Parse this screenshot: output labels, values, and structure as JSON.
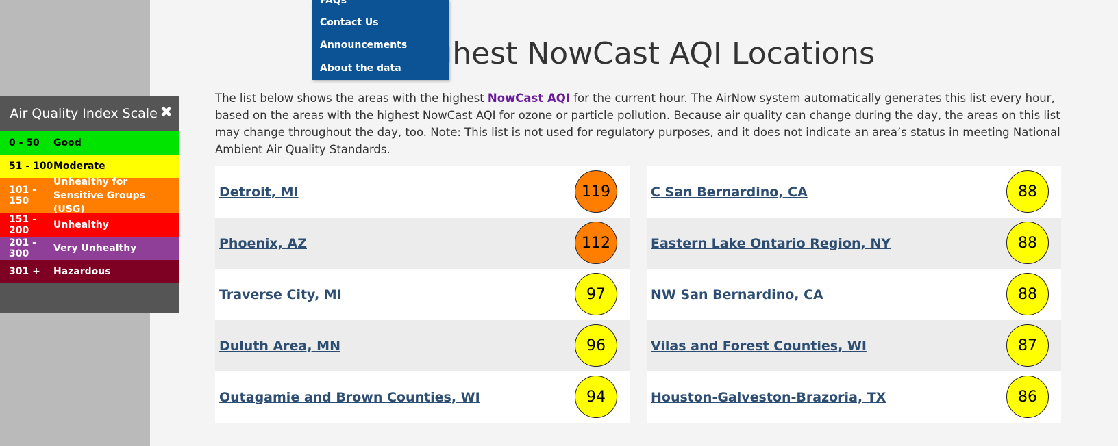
{
  "dropdown": {
    "items": [
      "FAQs",
      "Contact Us",
      "Announcements",
      "About the data"
    ]
  },
  "main": {
    "title": "Highest NowCast AQI Locations",
    "intro_before_link": "The list below shows the areas with the highest ",
    "intro_link": "NowCast AQI",
    "intro_after_link": " for the current hour. The AirNow system automatically generates this list every hour, based on the areas with the highest NowCast AQI for ozone or particle pollution. Because air quality can change during the day, the areas on this list may change throughout the day, too. Note: This list is not used for regulatory purposes, and it does not indicate an area’s status in meeting National Ambient Air Quality Standards."
  },
  "locations_left": [
    {
      "name": "Detroit, MI",
      "aqi": "119",
      "color": "#ff7e00"
    },
    {
      "name": "Phoenix, AZ",
      "aqi": "112",
      "color": "#ff7e00"
    },
    {
      "name": "Traverse City, MI",
      "aqi": "97",
      "color": "#ffff00"
    },
    {
      "name": "Duluth Area, MN",
      "aqi": "96",
      "color": "#ffff00"
    },
    {
      "name": "Outagamie and Brown Counties, WI",
      "aqi": "94",
      "color": "#ffff00"
    }
  ],
  "locations_right": [
    {
      "name": "C San Bernardino, CA",
      "aqi": "88",
      "color": "#ffff00"
    },
    {
      "name": "Eastern Lake Ontario Region, NY",
      "aqi": "88",
      "color": "#ffff00"
    },
    {
      "name": "NW San Bernardino, CA",
      "aqi": "88",
      "color": "#ffff00"
    },
    {
      "name": "Vilas and Forest Counties, WI",
      "aqi": "87",
      "color": "#ffff00"
    },
    {
      "name": "Houston-Galveston-Brazoria, TX",
      "aqi": "86",
      "color": "#ffff00"
    }
  ],
  "aqi_scale": {
    "title": "Air Quality Index Scale",
    "close_icon": "close-icon",
    "levels": [
      {
        "range": "0 - 50",
        "label": "Good",
        "bg": "#00e400",
        "fg": "#000000"
      },
      {
        "range": "51 - 100",
        "label": "Moderate",
        "bg": "#ffff00",
        "fg": "#000000"
      },
      {
        "range": "101 - 150",
        "label": "Unhealthy for Sensitive Groups (USG)",
        "bg": "#ff7e00",
        "fg": "#ffffff"
      },
      {
        "range": "151 - 200",
        "label": "Unhealthy",
        "bg": "#ff0000",
        "fg": "#ffffff"
      },
      {
        "range": "201 - 300",
        "label": "Very Unhealthy",
        "bg": "#8f3f97",
        "fg": "#ffffff"
      },
      {
        "range": "301 +",
        "label": "Hazardous",
        "bg": "#7e0023",
        "fg": "#ffffff"
      }
    ]
  }
}
